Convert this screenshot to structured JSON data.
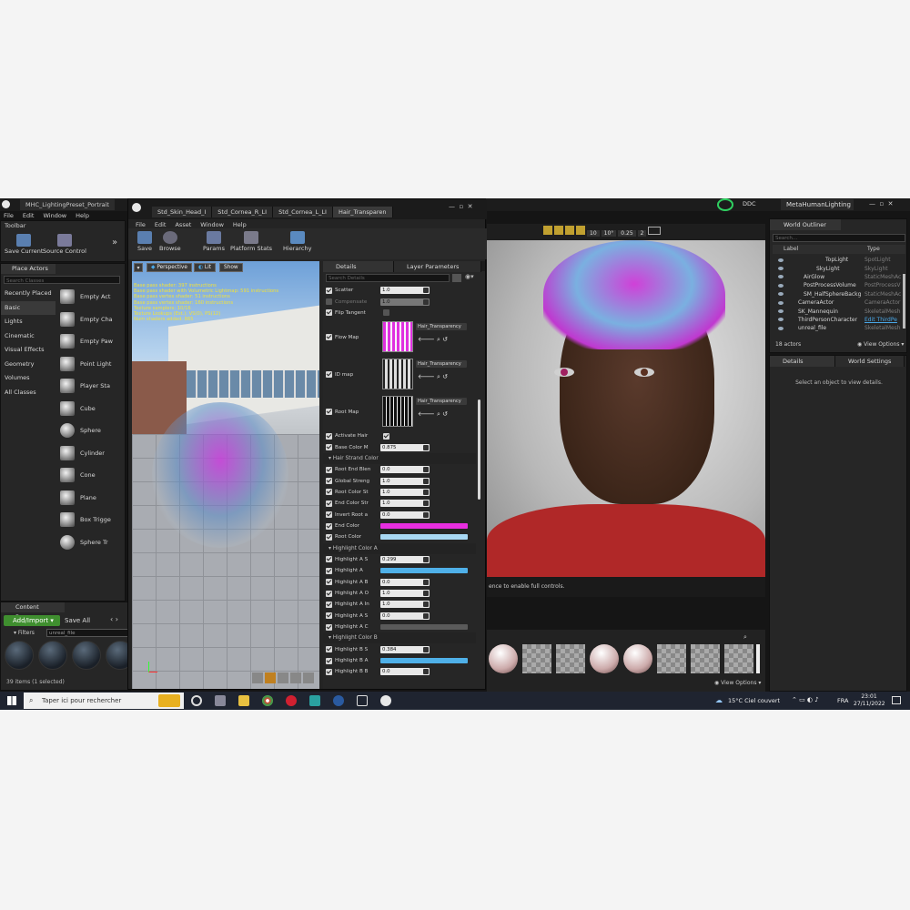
{
  "colors": {
    "accent_blue": "#4aa8e8",
    "magenta": "#e82ee0",
    "light_blue": "#a8d8f4",
    "highlight_blue": "#4fb0e8"
  },
  "editor": {
    "title": "MHC_LightingPreset_Portrait",
    "project": "MetaHumanLighting",
    "ddc": "DDC",
    "menu": [
      "File",
      "Edit",
      "Window",
      "Help"
    ],
    "toolbar_tab": "Toolbar",
    "save_current": "Save Current",
    "source_control": "Source Control"
  },
  "place_actors": {
    "tab": "Place Actors",
    "search_placeholder": "Search Classes",
    "categories": [
      "Recently Placed",
      "Basic",
      "Lights",
      "Cinematic",
      "Visual Effects",
      "Geometry",
      "Volumes",
      "All Classes"
    ],
    "actors": [
      "Empty Act",
      "Empty Cha",
      "Empty Paw",
      "Point Light",
      "Player Sta",
      "Cube",
      "Sphere",
      "Cylinder",
      "Cone",
      "Plane",
      "Box Trigge",
      "Sphere Tr"
    ]
  },
  "content_browser": {
    "tab": "Content Browser",
    "add_import": "Add/Import",
    "save_all": "Save All",
    "filters": "Filters",
    "search_value": "unreal_file",
    "items_count": "39 items (1 selected)"
  },
  "material_editor": {
    "tabs": [
      "Std_Skin_Head_I",
      "Std_Cornea_R_LI",
      "Std_Cornea_L_LI",
      "Hair_Transparen"
    ],
    "menu": [
      "File",
      "Edit",
      "Asset",
      "Window",
      "Help"
    ],
    "toolbar": [
      "Save",
      "Browse",
      "Params",
      "Platform Stats",
      "Hierarchy"
    ],
    "viewport_buttons": [
      "Perspective",
      "Lit",
      "Show"
    ],
    "stats": [
      "Base pass shader: 397 instructions",
      "Base pass shader with Volumetric Lightmap: 591 instructions",
      "Base pass vertex shader: 51 instructions",
      "Base pass vertex shader: 160 instructions",
      "Texture samplers: 10/16",
      "Texture Lookups (Est.): VS(0), PS(12)",
      "Num shaders added: 865"
    ],
    "details_tab": "Details",
    "layer_tab": "Layer Parameters",
    "search_details": "Search Details",
    "params_top": [
      {
        "label": "Scatter",
        "value": "1.0",
        "on": true
      },
      {
        "label": "Compensate",
        "value": "1.0",
        "on": false
      },
      {
        "label": "Flip Tangent",
        "value": "",
        "on": true
      }
    ],
    "textures": [
      {
        "label": "Flow Map",
        "asset": "Hair_Transparency"
      },
      {
        "label": "ID map",
        "asset": "Hair_Transparency"
      },
      {
        "label": "Root Map",
        "asset": "Hair_Transparency"
      }
    ],
    "activate_hair": "Activate Hair",
    "base_color_m": {
      "label": "Base Color M",
      "value": "0.875"
    },
    "hair_strand_section": "Hair Strand Color",
    "strand_params": [
      {
        "label": "Root End Blen",
        "value": "0.0"
      },
      {
        "label": "Global Streng",
        "value": "1.0"
      },
      {
        "label": "Root Color St",
        "value": "1.0"
      },
      {
        "label": "End Color Str",
        "value": "1.0"
      },
      {
        "label": "Invert Root a",
        "value": "0.0"
      }
    ],
    "end_color": "End Color",
    "root_color": "Root Color",
    "highlight_a_section": "Highlight Color A",
    "highlight_a": [
      {
        "label": "Highlight A S",
        "value": "0.299"
      },
      {
        "label": "Highlight A",
        "value": ""
      },
      {
        "label": "Highlight A B",
        "value": "0.0"
      },
      {
        "label": "Highlight A O",
        "value": "1.0"
      },
      {
        "label": "Highlight A In",
        "value": "1.0"
      },
      {
        "label": "Highlight A S",
        "value": "0.0"
      },
      {
        "label": "Highlight A C",
        "value": ""
      }
    ],
    "highlight_b_section": "Highlight Color B",
    "highlight_b": [
      {
        "label": "Highlight B S",
        "value": "0.384"
      },
      {
        "label": "Highlight B A",
        "value": ""
      },
      {
        "label": "Highlight B B",
        "value": "0.0"
      }
    ]
  },
  "viewport": {
    "toolbar_values": [
      "10",
      "10°",
      "0.25",
      "2"
    ],
    "notice": "ence to enable full controls."
  },
  "world_outliner": {
    "tab": "World Outliner",
    "search_placeholder": "Search...",
    "col_label": "Label",
    "col_type": "Type",
    "rows": [
      {
        "label": "TopLight",
        "type": "SpotLight"
      },
      {
        "label": "SkyLight",
        "type": "SkyLight"
      },
      {
        "label": "AirGlow",
        "type": "StaticMeshAc"
      },
      {
        "label": "PostProcessVolume",
        "type": "PostProcessV"
      },
      {
        "label": "SM_HalfSphereBackg",
        "type": "StaticMeshAc"
      },
      {
        "label": "CameraActor",
        "type": "CameraActor"
      },
      {
        "label": "SK_Mannequin",
        "type": "SkeletalMesh"
      },
      {
        "label": "ThirdPersonCharacter",
        "type": "Edit ThirdPe"
      },
      {
        "label": "unreal_file",
        "type": "SkeletalMesh"
      }
    ],
    "actors_count": "18 actors",
    "view_options": "View Options"
  },
  "details_panel": {
    "tab": "Details",
    "world_settings_tab": "World Settings",
    "empty_message": "Select an object to view details."
  },
  "bottom_view_options": "View Options",
  "taskbar": {
    "search_placeholder": "Taper ici pour rechercher",
    "weather": "15°C  Ciel couvert",
    "lang": "FRA",
    "time": "23:01",
    "date": "27/11/2022"
  }
}
